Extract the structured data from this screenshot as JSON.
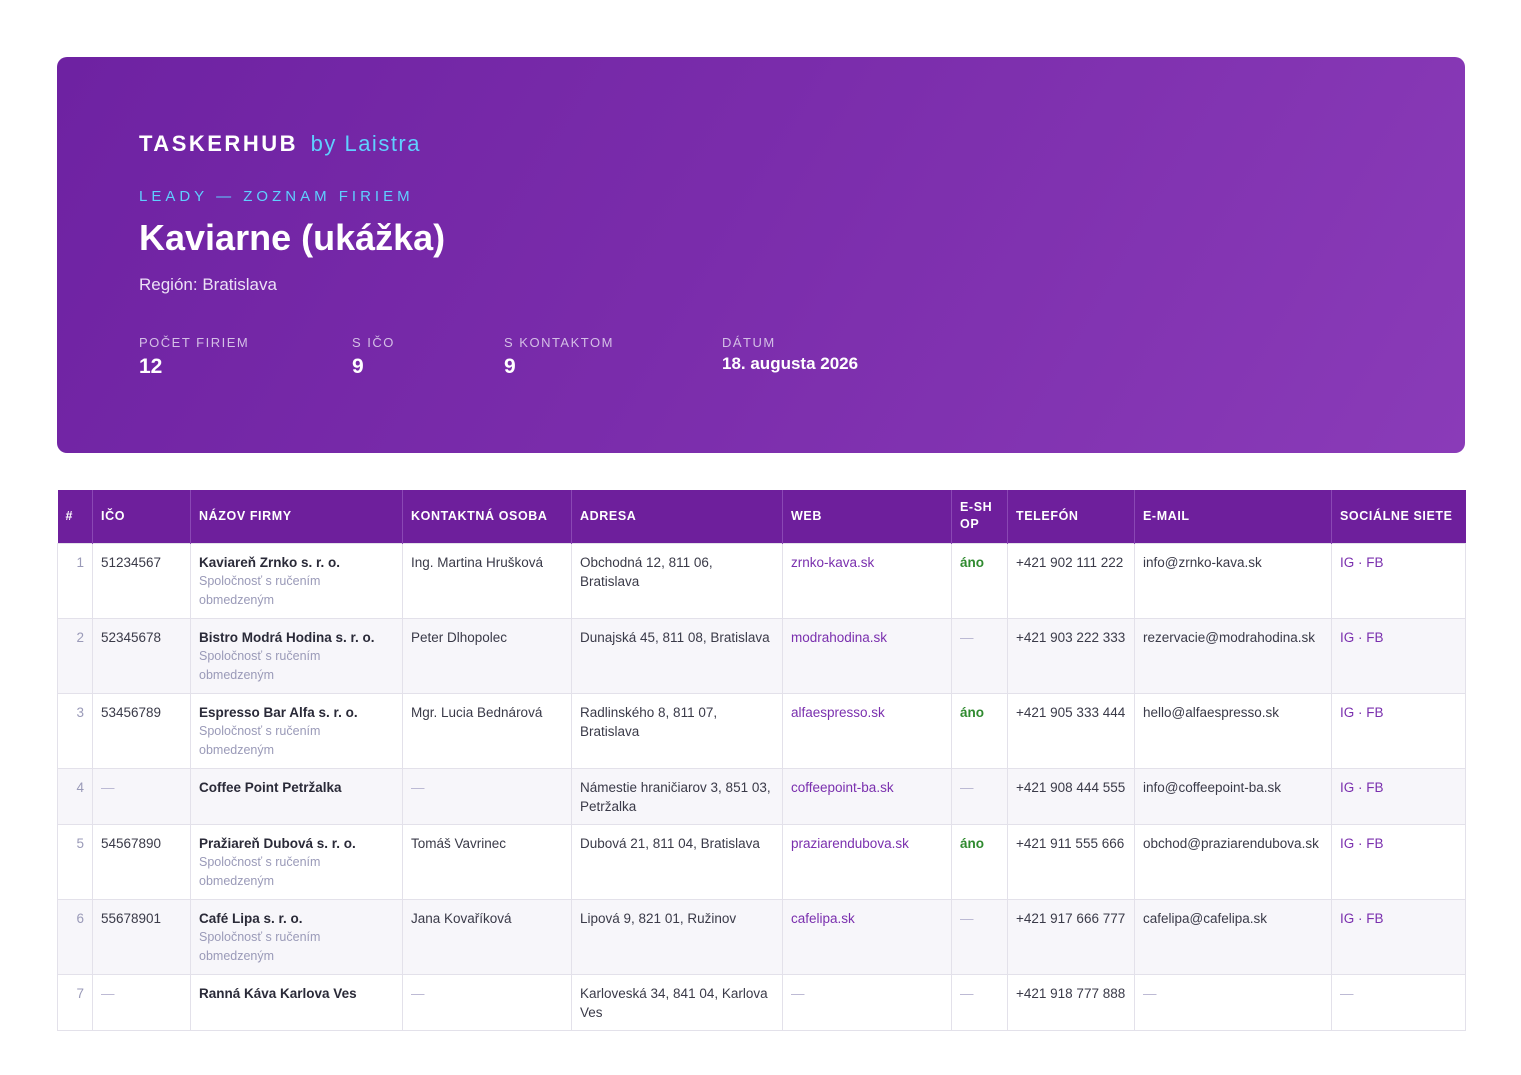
{
  "header": {
    "brand_name": "TASKERHUB",
    "brand_by": "by Laistra",
    "eyebrow": "LEADY — ZOZNAM FIRIEM",
    "title": "Kaviarne (ukážka)",
    "region": "Región: Bratislava",
    "stats": [
      {
        "label": "POČET FIRIEM",
        "value": "12"
      },
      {
        "label": "S IČO",
        "value": "9"
      },
      {
        "label": "S KONTAKTOM",
        "value": "9"
      },
      {
        "label": "DÁTUM",
        "value": "18. augusta 2026"
      }
    ]
  },
  "colors": {
    "accent": "#6e1f9c",
    "brand_by": "#5fd0ff",
    "link": "#7a2fae",
    "yes": "#2f8a2f"
  },
  "table": {
    "columns": [
      "#",
      "IČO",
      "NÁZOV FIRMY",
      "KONTAKTNÁ OSOBA",
      "ADRESA",
      "WEB",
      "E-SHOP",
      "TELEFÓN",
      "E-MAIL",
      "SOCIÁLNE SIETE"
    ],
    "rows": [
      {
        "n": "1",
        "ico": "51234567",
        "name": "Kaviareň Zrnko s. r. o.",
        "legal": "Spoločnosť s ručením obmedzeným",
        "contact": "Ing. Martina Hrušková",
        "address": "Obchodná 12, 811 06, Bratislava",
        "web": "zrnko-kava.sk",
        "eshop": "áno",
        "phone": "+421 902 111 222",
        "email": "info@zrnko-kava.sk",
        "social": "IG · FB"
      },
      {
        "n": "2",
        "ico": "52345678",
        "name": "Bistro Modrá Hodina s. r. o.",
        "legal": "Spoločnosť s ručením obmedzeným",
        "contact": "Peter Dlhopolec",
        "address": "Dunajská 45, 811 08, Bratislava",
        "web": "modrahodina.sk",
        "eshop": "—",
        "phone": "+421 903 222 333",
        "email": "rezervacie@modrahodina.sk",
        "social": "IG · FB"
      },
      {
        "n": "3",
        "ico": "53456789",
        "name": "Espresso Bar Alfa s. r. o.",
        "legal": "Spoločnosť s ručením obmedzeným",
        "contact": "Mgr. Lucia Bednárová",
        "address": "Radlinského 8, 811 07, Bratislava",
        "web": "alfaespresso.sk",
        "eshop": "áno",
        "phone": "+421 905 333 444",
        "email": "hello@alfaespresso.sk",
        "social": "IG · FB"
      },
      {
        "n": "4",
        "ico": "—",
        "name": "Coffee Point Petržalka",
        "legal": "",
        "contact": "—",
        "address": "Námestie hraničiarov 3, 851 03, Petržalka",
        "web": "coffeepoint-ba.sk",
        "eshop": "—",
        "phone": "+421 908 444 555",
        "email": "info@coffeepoint-ba.sk",
        "social": "IG · FB"
      },
      {
        "n": "5",
        "ico": "54567890",
        "name": "Pražiareň Dubová s. r. o.",
        "legal": "Spoločnosť s ručením obmedzeným",
        "contact": "Tomáš Vavrinec",
        "address": "Dubová 21, 811 04, Bratislava",
        "web": "praziarendubova.sk",
        "eshop": "áno",
        "phone": "+421 911 555 666",
        "email": "obchod@praziarendubova.sk",
        "social": "IG · FB"
      },
      {
        "n": "6",
        "ico": "55678901",
        "name": "Café Lipa s. r. o.",
        "legal": "Spoločnosť s ručením obmedzeným",
        "contact": "Jana Kovaříková",
        "address": "Lipová 9, 821 01, Ružinov",
        "web": "cafelipa.sk",
        "eshop": "—",
        "phone": "+421 917 666 777",
        "email": "cafelipa@cafelipa.sk",
        "social": "IG · FB"
      },
      {
        "n": "7",
        "ico": "—",
        "name": "Ranná Káva Karlova Ves",
        "legal": "",
        "contact": "—",
        "address": "Karloveská 34, 841 04, Karlova Ves",
        "web": "—",
        "eshop": "—",
        "phone": "+421 918 777 888",
        "email": "—",
        "social": "—"
      }
    ]
  }
}
